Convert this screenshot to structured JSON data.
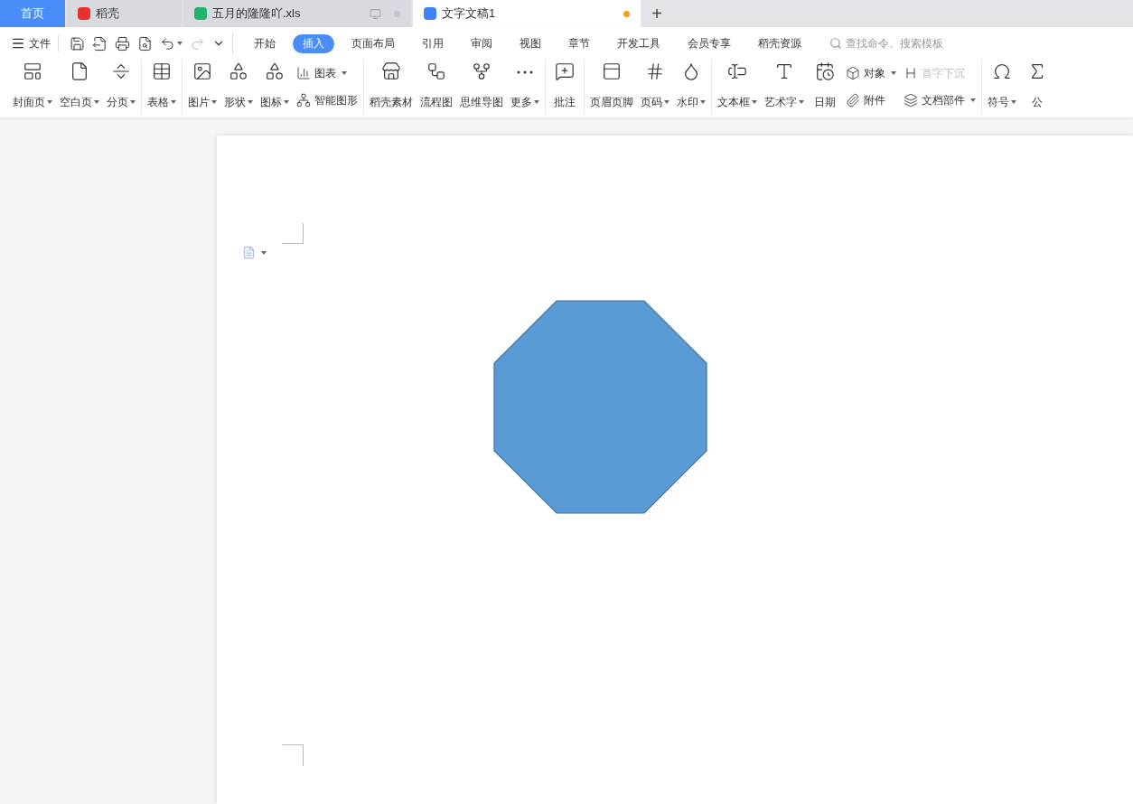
{
  "tabs": [
    {
      "kind": "home",
      "label": "首页",
      "selected": false
    },
    {
      "kind": "docer",
      "label": "稻壳",
      "selected": false
    },
    {
      "kind": "sheet",
      "label": "五月的隆隆吖.xls",
      "selected": false,
      "unsaved": false
    },
    {
      "kind": "writer",
      "label": "文字文稿1",
      "selected": true,
      "unsaved": true
    }
  ],
  "add_tab": "+",
  "file_menu": "文件",
  "menu": [
    {
      "label": "开始",
      "selected": false
    },
    {
      "label": "插入",
      "selected": true
    },
    {
      "label": "页面布局",
      "selected": false
    },
    {
      "label": "引用",
      "selected": false
    },
    {
      "label": "审阅",
      "selected": false
    },
    {
      "label": "视图",
      "selected": false
    },
    {
      "label": "章节",
      "selected": false
    },
    {
      "label": "开发工具",
      "selected": false
    },
    {
      "label": "会员专享",
      "selected": false
    },
    {
      "label": "稻壳资源",
      "selected": false
    }
  ],
  "search": {
    "placeholder": "查找命令、搜索模板"
  },
  "ribbon": [
    [
      {
        "kind": "large",
        "label": "封面页",
        "dropdown": true
      },
      {
        "kind": "large",
        "label": "空白页",
        "dropdown": true
      },
      {
        "kind": "large",
        "label": "分页",
        "dropdown": true
      }
    ],
    [
      {
        "kind": "large",
        "label": "表格",
        "dropdown": true
      }
    ],
    [
      {
        "kind": "large",
        "label": "图片",
        "dropdown": true
      },
      {
        "kind": "large",
        "label": "形状",
        "dropdown": true
      },
      {
        "kind": "large",
        "label": "图标",
        "dropdown": true
      },
      {
        "kind": "stack",
        "items": [
          {
            "label": "图表",
            "dropdown": true,
            "disabled": false
          },
          {
            "label": "智能图形",
            "dropdown": false,
            "disabled": false
          }
        ]
      }
    ],
    [
      {
        "kind": "large",
        "label": "稻壳素材",
        "dropdown": false
      },
      {
        "kind": "large",
        "label": "流程图",
        "dropdown": false
      },
      {
        "kind": "large",
        "label": "思维导图",
        "dropdown": false
      },
      {
        "kind": "large",
        "label": "更多",
        "dropdown": true
      }
    ],
    [
      {
        "kind": "large",
        "label": "批注",
        "dropdown": false
      }
    ],
    [
      {
        "kind": "large",
        "label": "页眉页脚",
        "dropdown": false
      },
      {
        "kind": "large",
        "label": "页码",
        "dropdown": true
      },
      {
        "kind": "large",
        "label": "水印",
        "dropdown": true
      }
    ],
    [
      {
        "kind": "large",
        "label": "文本框",
        "dropdown": true
      },
      {
        "kind": "large",
        "label": "艺术字",
        "dropdown": true
      },
      {
        "kind": "large",
        "label": "日期",
        "dropdown": false
      },
      {
        "kind": "stack",
        "items": [
          {
            "label": "对象",
            "dropdown": true,
            "disabled": false
          },
          {
            "label": "附件",
            "dropdown": false,
            "disabled": false
          }
        ]
      },
      {
        "kind": "stack",
        "items": [
          {
            "label": "首字下沉",
            "dropdown": false,
            "disabled": true
          },
          {
            "label": "文档部件",
            "dropdown": true,
            "disabled": false
          }
        ]
      }
    ],
    [
      {
        "kind": "large",
        "label": "符号",
        "dropdown": true
      },
      {
        "kind": "large",
        "label": "公",
        "dropdown": false
      }
    ]
  ],
  "document": {
    "shape": {
      "kind": "octagon",
      "color": "#5b9bd5"
    }
  }
}
